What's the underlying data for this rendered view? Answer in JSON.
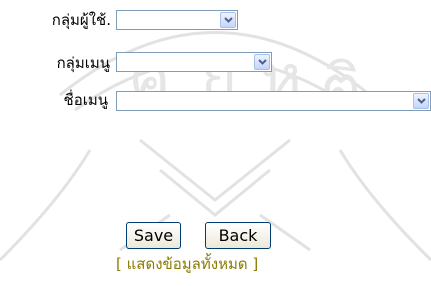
{
  "form": {
    "user_group_label": "กลุ่มผู้ใช้.",
    "user_group_value": "",
    "menu_group_label": "กลุ่มเมนู",
    "menu_group_value": "",
    "menu_name_label": "ชื่อเมนู",
    "menu_name_value": ""
  },
  "actions": {
    "save_label": "Save",
    "back_label": "Back",
    "show_all_open": "[",
    "show_all_label": "แสดงข้อมูลทั้งหมด",
    "show_all_close": "]"
  },
  "colors": {
    "select_border": "#7f9db9",
    "dropdown_arrow": "#4d6185",
    "button_border": "#003c74",
    "link_color": "#8a7a00",
    "watermark": "#d9d9d9"
  }
}
